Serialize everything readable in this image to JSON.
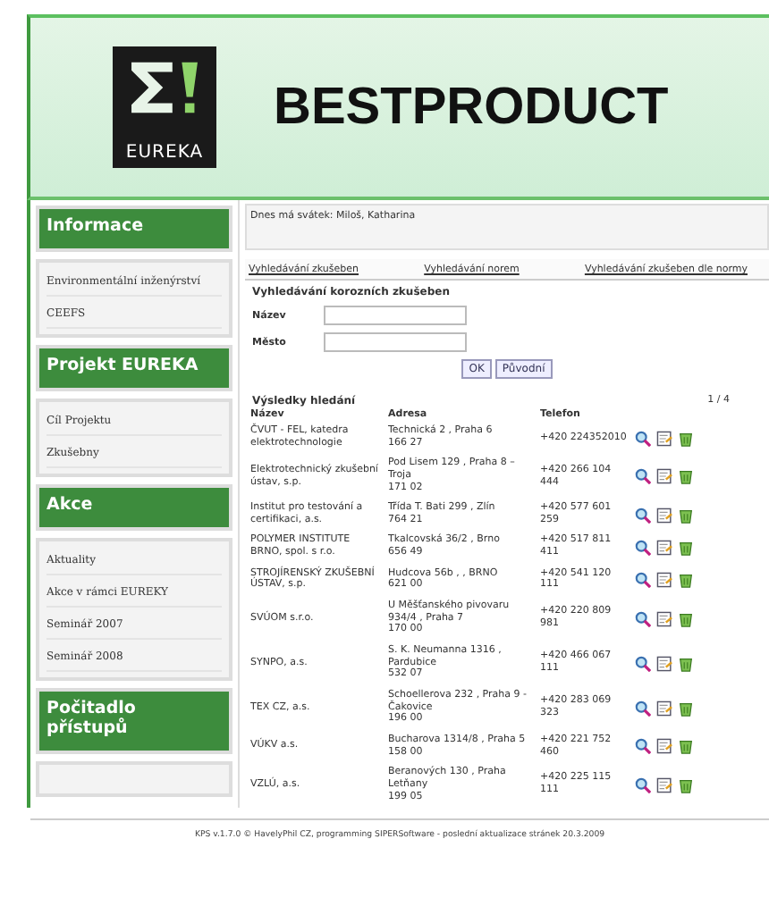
{
  "header": {
    "logo_text": "EUREKA",
    "title": "BESTPRODUCT"
  },
  "sidebar": [
    {
      "heading": "Informace",
      "items": [
        "Environmentální inženýrství",
        "CEEFS"
      ]
    },
    {
      "heading": "Projekt EUREKA",
      "items": [
        "Cíl Projektu",
        "Zkušebny"
      ]
    },
    {
      "heading": "Akce",
      "items": [
        "Aktuality",
        "Akce v rámci EUREKY",
        "Seminář 2007",
        "Seminář 2008"
      ]
    },
    {
      "heading": "Počitadlo přístupů"
    }
  ],
  "nameday": "Dnes má svátek: Miloš, Katharina",
  "search_tabs": [
    "Vyhledávání zkušeben",
    "Vyhledávání norem",
    "Vyhledávání zkušeben dle normy"
  ],
  "search": {
    "title": "Vyhledávání korozních zkušeben",
    "fields": [
      {
        "label": "Název"
      },
      {
        "label": "Město"
      }
    ],
    "buttons": [
      "OK",
      "Původní"
    ]
  },
  "results": {
    "title": "Výsledky hledání",
    "pager": "1 / 4",
    "columns": [
      "Název",
      "Adresa",
      "Telefon"
    ],
    "rows": [
      {
        "name": "ČVUT - FEL, katedra elektrotechnologie",
        "address": [
          "Technická 2 , Praha 6",
          "166 27"
        ],
        "phone": "+420 224352010"
      },
      {
        "name": "Elektrotechnický zkušební ústav, s.p.",
        "address": [
          "Pod Lisem 129 , Praha 8 –",
          "Troja",
          "171 02"
        ],
        "phone": "+420 266 104 444"
      },
      {
        "name": "Institut pro testování a certifikaci, a.s.",
        "address": [
          "Třída T. Bati 299 , Zlín",
          "764 21"
        ],
        "phone": "+420 577 601 259"
      },
      {
        "name": "POLYMER INSTITUTE BRNO, spol. s r.o.",
        "address": [
          "Tkalcovská 36/2 , Brno",
          "656 49"
        ],
        "phone": "+420 517 811 411"
      },
      {
        "name": "STROJÍRENSKÝ ZKUŠEBNÍ ÚSTAV, s.p.",
        "address": [
          "Hudcova 56b , , BRNO",
          "621 00"
        ],
        "phone": "+420 541 120 111"
      },
      {
        "name": "SVÚOM s.r.o.",
        "address": [
          "U Měšťanského pivovaru",
          "934/4 , Praha 7",
          "170 00"
        ],
        "phone": "+420 220 809 981"
      },
      {
        "name": "SYNPO, a.s.",
        "address": [
          "S. K. Neumanna 1316 ,",
          "Pardubice",
          "532 07"
        ],
        "phone": "+420 466 067 111"
      },
      {
        "name": "TEX CZ, a.s.",
        "address": [
          "Schoellerova 232 , Praha 9 -",
          "Čakovice",
          "196 00"
        ],
        "phone": "+420 283 069 323"
      },
      {
        "name": "VÚKV a.s.",
        "address": [
          "Bucharova 1314/8 , Praha 5",
          "158 00"
        ],
        "phone": "+420 221 752 460"
      },
      {
        "name": "VZLÚ, a.s.",
        "address": [
          "Beranových 130 , Praha",
          "Letňany",
          "199 05"
        ],
        "phone": "+420 225 115 111"
      }
    ]
  },
  "footer": "KPS v.1.7.0 © HavelyPhil CZ, programming SIPERSoftware - poslední aktualizace stránek 20.3.2009"
}
